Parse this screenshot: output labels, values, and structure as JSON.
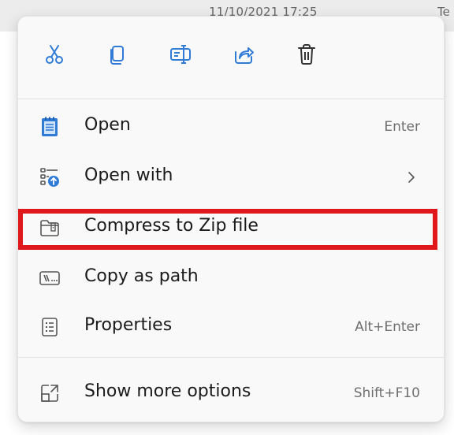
{
  "background": {
    "date_text": "11/10/2021 17:25",
    "type_text": "Te"
  },
  "toolbar": {
    "buttons": [
      {
        "name": "cut-icon"
      },
      {
        "name": "copy-icon"
      },
      {
        "name": "rename-icon"
      },
      {
        "name": "share-icon"
      },
      {
        "name": "delete-icon"
      }
    ]
  },
  "menu": {
    "items": [
      {
        "label": "Open",
        "shortcut": "Enter",
        "icon": "notepad-icon"
      },
      {
        "label": "Open with",
        "shortcut": "",
        "icon": "open-with-icon",
        "has_submenu": true
      },
      {
        "label": "Compress to Zip file",
        "shortcut": "",
        "icon": "zip-folder-icon",
        "highlighted": true
      },
      {
        "label": "Copy as path",
        "shortcut": "",
        "icon": "copy-path-icon"
      },
      {
        "label": "Properties",
        "shortcut": "Alt+Enter",
        "icon": "properties-icon"
      },
      {
        "label": "Show more options",
        "shortcut": "Shift+F10",
        "icon": "show-more-icon"
      }
    ]
  },
  "colors": {
    "accent": "#2f7bd6",
    "highlight": "#e0181b",
    "text": "#1b1b1b",
    "shortcut_text": "#6f6f6f"
  }
}
